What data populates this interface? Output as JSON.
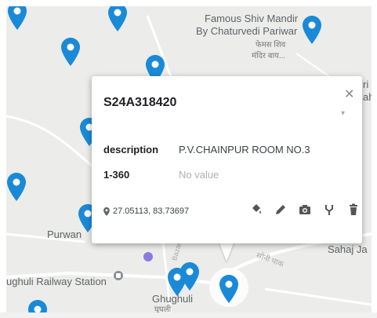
{
  "map": {
    "places": {
      "temple_en_line1": "Famous Shiv Mandir",
      "temple_en_line2": "By Chaturvedi Pariwar",
      "temple_hi_line1": "फेमस शिव",
      "temple_hi_line2": "मंदिर बाय...",
      "purwan": "Purwan",
      "railway_station": "ughuli Railway Station",
      "ghughuli": "Ghughuli",
      "ghughuli_hi": "घुघली",
      "sahaj": "Sahaj Ja",
      "sonvi_hi": "सोनी पाक",
      "right_edge_1": "ri M",
      "right_edge_2": "aha",
      "road_label": "Bazar"
    },
    "pin_color": "#1a8ad8"
  },
  "popup": {
    "title": "S24A318420",
    "rows": [
      {
        "label": "description",
        "value": "P.V.CHAINPUR ROOM NO.3"
      },
      {
        "label": "1-360",
        "value": "No value"
      }
    ],
    "coordinates": "27.05113, 83.73697",
    "icons": [
      "pin-icon",
      "paint-bucket-icon",
      "pencil-icon",
      "camera-icon",
      "route-icon",
      "trash-icon"
    ]
  }
}
